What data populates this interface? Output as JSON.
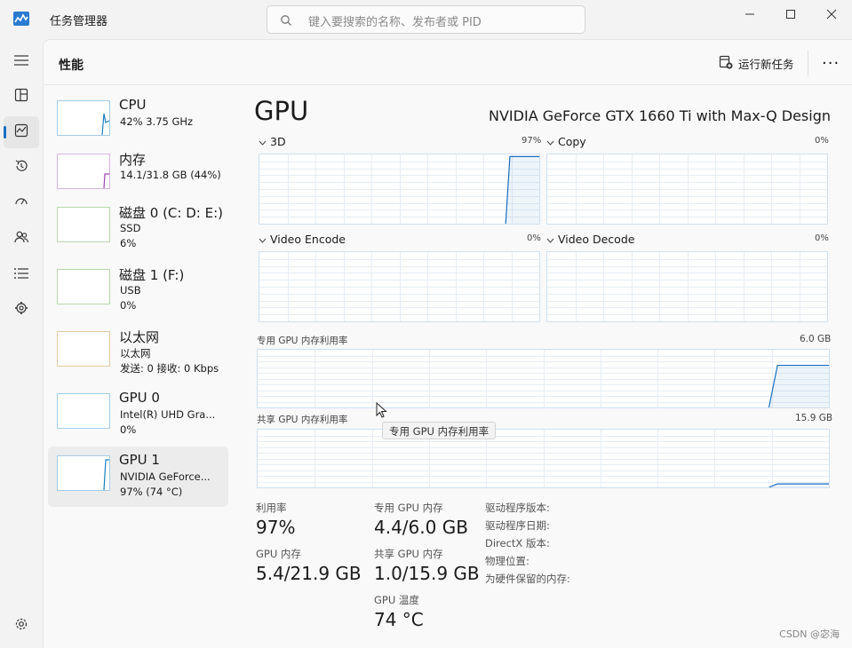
{
  "app": {
    "title": "任务管理器",
    "search_placeholder": "键入要搜索的名称、发布者或 PID",
    "accent": "#1a6fc2"
  },
  "window_controls": {
    "minimize_icon": "minimize-icon",
    "maximize_icon": "maximize-icon",
    "close_icon": "close-icon"
  },
  "rail": {
    "items": [
      {
        "icon": "hamburger-menu-icon"
      },
      {
        "icon": "processes-icon"
      },
      {
        "icon": "performance-icon",
        "active": true
      },
      {
        "icon": "app-history-icon"
      },
      {
        "icon": "startup-apps-icon"
      },
      {
        "icon": "users-icon"
      },
      {
        "icon": "details-icon"
      },
      {
        "icon": "services-icon"
      },
      {
        "icon": "settings-icon"
      }
    ]
  },
  "header": {
    "title": "性能",
    "run_task_label": "运行新任务",
    "more_label": "···"
  },
  "devices": [
    {
      "name": "CPU",
      "line1": "42% 3.75 GHz",
      "line2": "",
      "thumb_color": "#1a7fc5"
    },
    {
      "name": "内存",
      "line1": "14.1/31.8 GB (44%)",
      "line2": "",
      "thumb_color": "#a142b5"
    },
    {
      "name": "磁盘 0 (C: D: E:)",
      "line1": "SSD",
      "line2": "6%",
      "thumb_color": "#4d9a2a"
    },
    {
      "name": "磁盘 1 (F:)",
      "line1": "USB",
      "line2": "0%",
      "thumb_color": "#4d9a2a"
    },
    {
      "name": "以太网",
      "line1": "以太网",
      "line2": "发送: 0 接收: 0 Kbps",
      "thumb_color": "#b8781a"
    },
    {
      "name": "GPU 0",
      "line1": "Intel(R) UHD Gra...",
      "line2": "0%",
      "thumb_color": "#1a7fc5"
    },
    {
      "name": "GPU 1",
      "line1": "NVIDIA GeForce...",
      "line2": "97% (74 °C)",
      "thumb_color": "#1a7fc5",
      "selected": true
    }
  ],
  "gpu": {
    "title": "GPU",
    "model": "NVIDIA GeForce GTX 1660 Ti with Max-Q Design",
    "engines": [
      {
        "name": "3D",
        "pct": "97%",
        "level": 0.97
      },
      {
        "name": "Copy",
        "pct": "0%",
        "level": 0
      },
      {
        "name": "Video Encode",
        "pct": "0%",
        "level": 0
      },
      {
        "name": "Video Decode",
        "pct": "0%",
        "level": 0
      }
    ],
    "dedicated_mem": {
      "label": "专用 GPU 内存利用率",
      "max": "6.0 GB",
      "level": 0.73
    },
    "shared_mem": {
      "label": "共享 GPU 内存利用率",
      "max": "15.9 GB",
      "level": 0.06
    },
    "tooltip": "专用 GPU 内存利用率",
    "stats": {
      "utilization_label": "利用率",
      "utilization_value": "97%",
      "gpu_mem_label": "GPU 内存",
      "gpu_mem_value": "5.4/21.9 GB",
      "dedicated_label": "专用 GPU 内存",
      "dedicated_value": "4.4/6.0 GB",
      "shared_label": "共享 GPU 内存",
      "shared_value": "1.0/15.9 GB",
      "temp_label": "GPU 温度",
      "temp_value": "74 °C"
    },
    "info": {
      "driver_version_label": "驱动程序版本:",
      "driver_date_label": "驱动程序日期:",
      "directx_label": "DirectX 版本:",
      "location_label": "物理位置:",
      "reserved_label": "为硬件保留的内存:"
    }
  },
  "watermark": "CSDN @宓海"
}
